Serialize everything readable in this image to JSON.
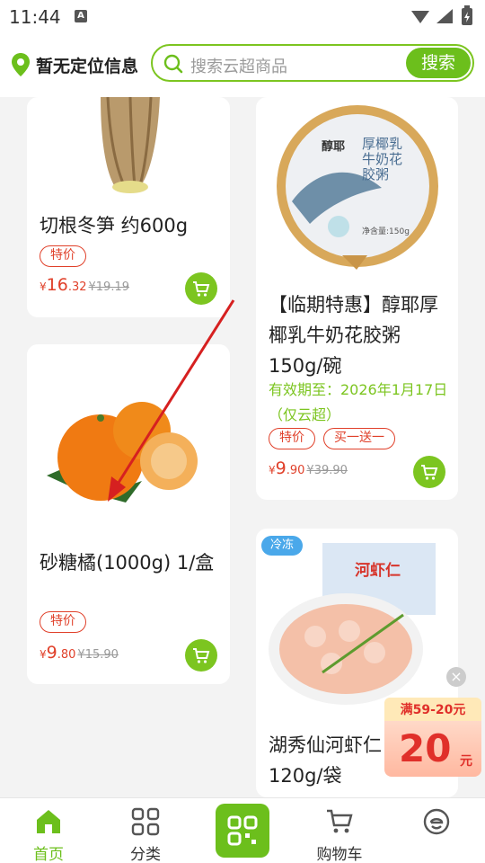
{
  "status_bar": {
    "time": "11:44",
    "notif_letter": "A"
  },
  "header": {
    "location_text": "暂无定位信息",
    "search_placeholder": "搜索云超商品",
    "search_button": "搜索"
  },
  "products": [
    {
      "title": "切根冬笋 约600g",
      "tags": [
        "特价"
      ],
      "price_cur": "¥",
      "price_int": "16",
      "price_dec": ".32",
      "old_price": "¥19.19"
    },
    {
      "title": "【临期特惠】醇耶厚椰乳牛奶花胶粥150g/碗",
      "expiry": "有效期至：2026年1月17日（仅云超）",
      "tags": [
        "特价",
        "买一送一"
      ],
      "price_cur": "¥",
      "price_int": "9",
      "price_dec": ".90",
      "old_price": "¥39.90",
      "image_texts": {
        "brand": "醇耶",
        "name": "厚椰乳牛奶花胶粥",
        "net": "净含量:150g"
      }
    },
    {
      "title": "砂糖橘(1000g) 1/盒",
      "tags": [
        "特价"
      ],
      "price_cur": "¥",
      "price_int": "9",
      "price_dec": ".80",
      "old_price": "¥15.90"
    },
    {
      "title": "湖秀仙河虾仁120g/袋",
      "badge": "冷冻",
      "image_texts": {
        "pack": "河虾仁"
      }
    }
  ],
  "promo": {
    "threshold": "满59-20元",
    "amount": "20",
    "unit": "元",
    "close": "×"
  },
  "nav": {
    "items": [
      {
        "label": "首页",
        "icon": "home-icon",
        "active": true
      },
      {
        "label": "分类",
        "icon": "category-icon",
        "active": false
      },
      {
        "label": "",
        "icon": "scan-icon",
        "active": false
      },
      {
        "label": "购物车",
        "icon": "cart-icon",
        "active": false
      },
      {
        "label": "",
        "icon": "profile-icon",
        "active": false
      }
    ]
  },
  "colors": {
    "brand_green": "#6cbf1c",
    "price_red": "#e0402a",
    "cold_blue": "#4aa8ea"
  }
}
